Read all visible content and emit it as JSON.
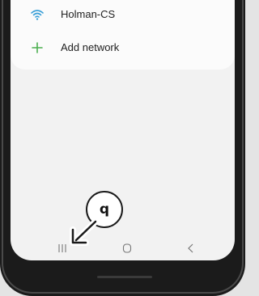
{
  "networks": [
    {
      "label": "Holman-CS",
      "icon": "wifi-icon"
    }
  ],
  "add_network": {
    "label": "Add network",
    "icon": "plus-icon"
  },
  "nav": {
    "recents_icon": "recents-icon",
    "home_icon": "home-icon",
    "back_icon": "back-icon"
  },
  "callout": {
    "key": "q"
  },
  "colors": {
    "accent_wifi": "#3aa0d8",
    "accent_plus": "#4caf50"
  }
}
